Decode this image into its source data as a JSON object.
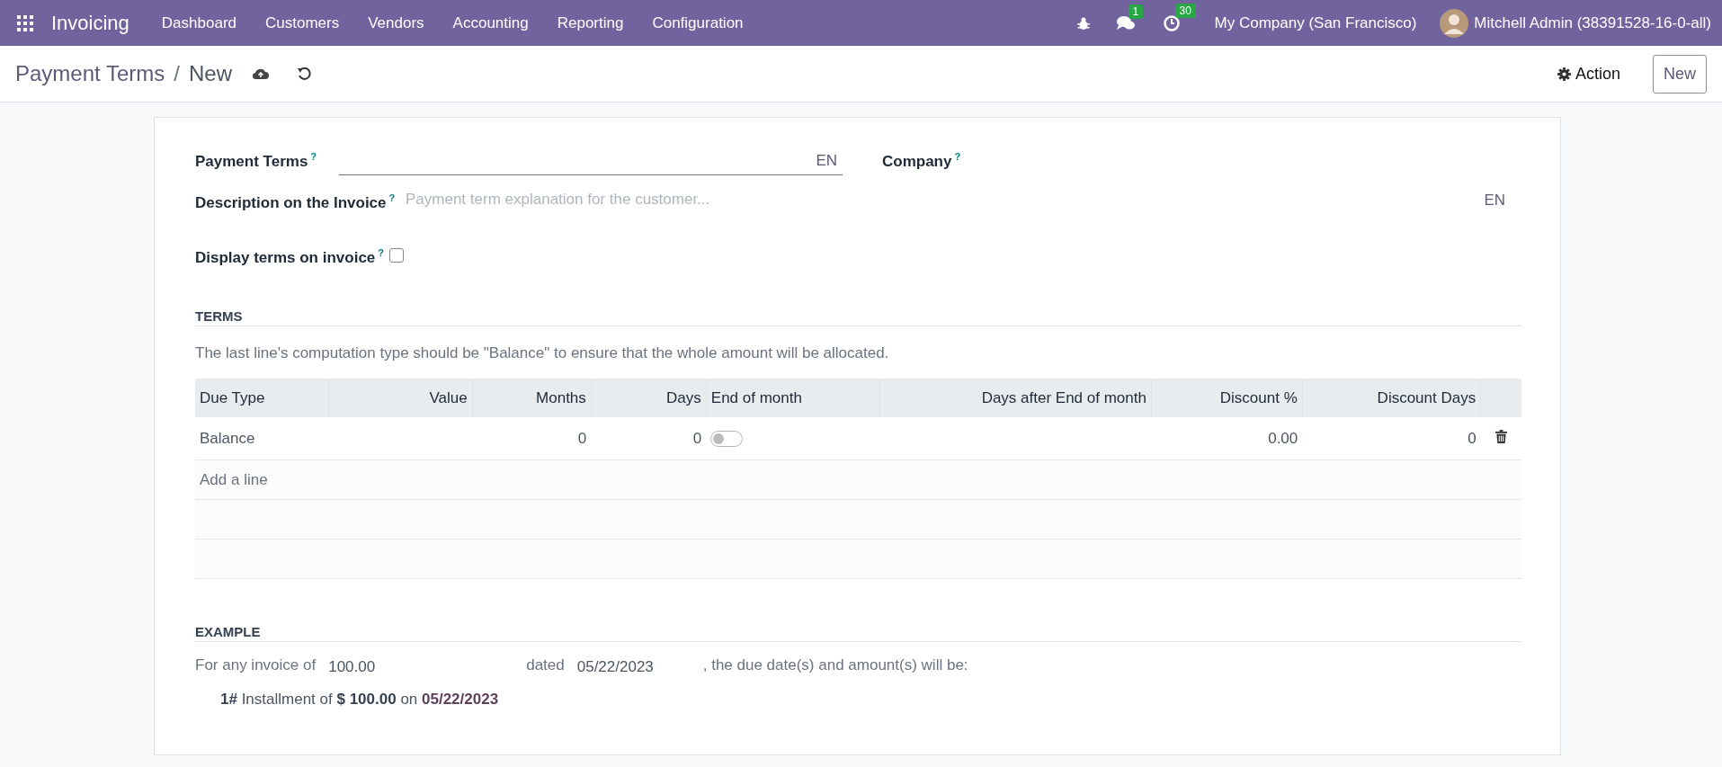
{
  "navbar": {
    "app_name": "Invoicing",
    "menu": [
      "Dashboard",
      "Customers",
      "Vendors",
      "Accounting",
      "Reporting",
      "Configuration"
    ],
    "messages_badge": "1",
    "activities_badge": "30",
    "company": "My Company (San Francisco)",
    "user": "Mitchell Admin (38391528-16-0-all)"
  },
  "breadcrumb": {
    "parent": "Payment Terms",
    "separator": "/",
    "current": "New"
  },
  "actions": {
    "action": "Action",
    "new": "New"
  },
  "form": {
    "payment_terms": {
      "label": "Payment Terms",
      "help": "?",
      "lang": "EN"
    },
    "company": {
      "label": "Company",
      "help": "?"
    },
    "description": {
      "label": "Description on the Invoice",
      "help": "?",
      "placeholder": "Payment term explanation for the customer...",
      "lang": "EN"
    },
    "display_terms": {
      "label": "Display terms on invoice",
      "help": "?",
      "checked": false
    }
  },
  "terms": {
    "title": "TERMS",
    "note": "The last line's computation type should be \"Balance\" to ensure that the whole amount will be allocated.",
    "columns": [
      "Due Type",
      "Value",
      "Months",
      "Days",
      "End of month",
      "Days after End of month",
      "Discount %",
      "Discount Days"
    ],
    "rows": [
      {
        "due_type": "Balance",
        "months": "0",
        "days": "0",
        "end_of_month": false,
        "discount": "0.00",
        "discount_days": "0"
      }
    ],
    "add_line": "Add a line"
  },
  "example": {
    "title": "EXAMPLE",
    "prefix": "For any invoice of",
    "amount": "100.00",
    "dated": "dated",
    "date": "05/22/2023",
    "suffix": ", the due date(s) and amount(s) will be:",
    "installments": [
      "**1#** Installment of **$ 100.00** on **05/22/2023**"
    ]
  }
}
